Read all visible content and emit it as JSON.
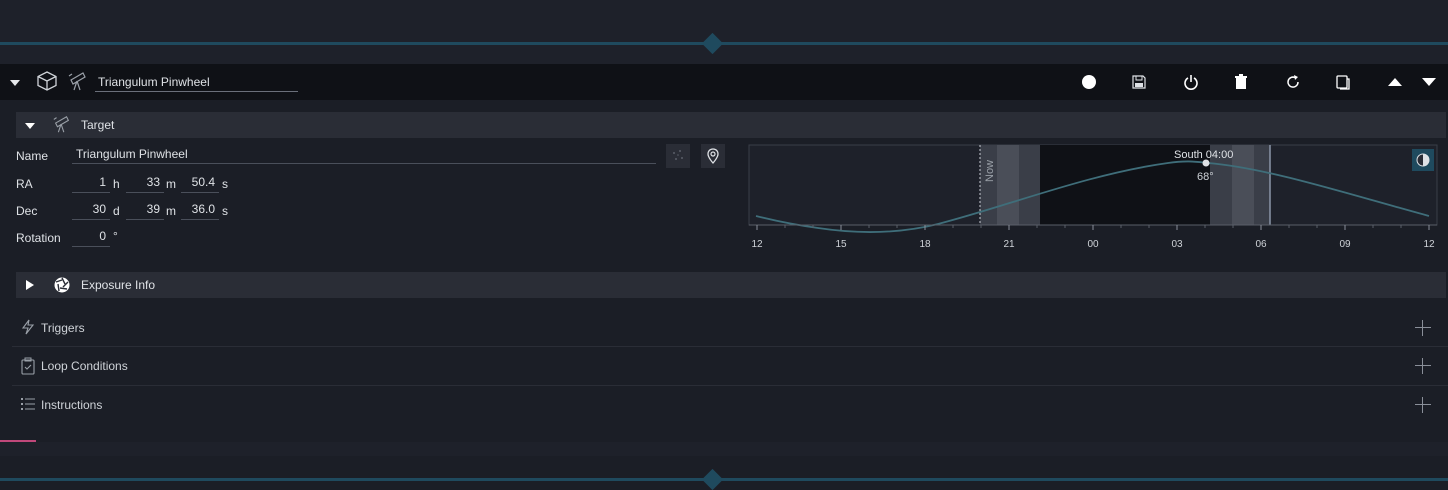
{
  "sequence": {
    "title": "Triangulum Pinwheel"
  },
  "target_section": {
    "title": "Target",
    "name_label": "Name",
    "name_value": "Triangulum Pinwheel",
    "ra_label": "RA",
    "ra_h": "1",
    "ra_h_unit": "h",
    "ra_m": "33",
    "ra_m_unit": "m",
    "ra_s": "50.4",
    "ra_s_unit": "s",
    "dec_label": "Dec",
    "dec_d": "30",
    "dec_d_unit": "d",
    "dec_m": "39",
    "dec_m_unit": "m",
    "dec_s": "36.0",
    "dec_s_unit": "s",
    "rotation_label": "Rotation",
    "rotation_value": "0",
    "rotation_unit": "°"
  },
  "altitude_chart": {
    "now_label": "Now",
    "south_label": "South 04:00",
    "peak_label": "68°",
    "x_ticks": [
      "12",
      "15",
      "18",
      "21",
      "00",
      "03",
      "06",
      "09",
      "12"
    ]
  },
  "chart_data": {
    "type": "line",
    "xlabel": "",
    "ylabel": "",
    "x": [
      "12:00",
      "15:00",
      "18:00",
      "21:00",
      "00:00",
      "03:00",
      "04:00",
      "06:00",
      "09:00",
      "12:00"
    ],
    "series": [
      {
        "values": [
          -5,
          -15,
          -8,
          15,
          45,
          66,
          68,
          62,
          35,
          5
        ]
      }
    ],
    "ylim": [
      -20,
      90
    ],
    "annotations": [
      "Now",
      "South 04:00",
      "68°"
    ]
  },
  "exposure": {
    "title": "Exposure Info"
  },
  "triggers": {
    "label": "Triggers"
  },
  "loop_conditions": {
    "label": "Loop Conditions"
  },
  "instructions": {
    "label": "Instructions"
  },
  "colors": {
    "accent": "#1f4a5e",
    "curve": "#3f6e7a",
    "progress": "#c0487a"
  }
}
